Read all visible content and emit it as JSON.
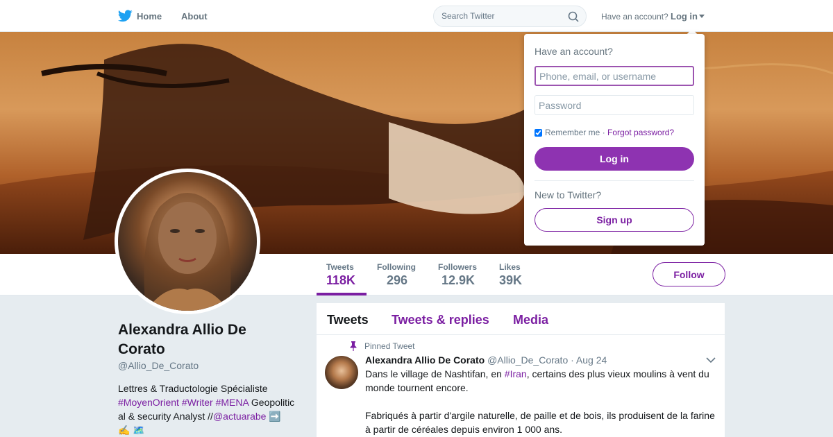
{
  "nav": {
    "logo_icon": "twitter-bird-icon",
    "home": "Home",
    "about": "About",
    "search_placeholder": "Search Twitter",
    "have_account": "Have an account?",
    "login": "Log in"
  },
  "profile": {
    "name": "Alexandra Allio De Corato",
    "handle": "@Allio_De_Corato",
    "bio_line1": "Lettres & Traductologie Spécialiste",
    "bio_hashtags": "#MoyenOrient #Writer #MENA",
    "bio_line2a": " Geopolitic",
    "bio_line2b": "al & security Analyst //",
    "bio_mention": "@actuarabe",
    "bio_emoji": "➡️",
    "bio_line3": "✍️ 🗺️"
  },
  "stats": [
    {
      "label": "Tweets",
      "value": "118K"
    },
    {
      "label": "Following",
      "value": "296"
    },
    {
      "label": "Followers",
      "value": "12.9K"
    },
    {
      "label": "Likes",
      "value": "39K"
    }
  ],
  "follow_label": "Follow",
  "tabs": [
    "Tweets",
    "Tweets & replies",
    "Media"
  ],
  "tweet": {
    "pinned_label": "Pinned Tweet",
    "name": "Alexandra Allio De Corato",
    "meta": "@Allio_De_Corato · Aug 24",
    "p1_before": "Dans le village de Nashtifan, en ",
    "p1_hashtag": "#Iran",
    "p1_after": ", certains des plus vieux moulins à vent du monde tournent encore.",
    "p2": "Fabriqués à partir d'argile naturelle, de paille et de bois, ils produisent de la farine à partir de céréales depuis environ 1 000 ans."
  },
  "login_dropdown": {
    "title": "Have an account?",
    "username_placeholder": "Phone, email, or username",
    "password_placeholder": "Password",
    "remember": "Remember me",
    "separator": " · ",
    "forgot": "Forgot password?",
    "login_button": "Log in",
    "new_to": "New to Twitter?",
    "signup_button": "Sign up"
  },
  "colors": {
    "accent": "#7b1fa2",
    "login_button_bg": "#8e33b1"
  }
}
